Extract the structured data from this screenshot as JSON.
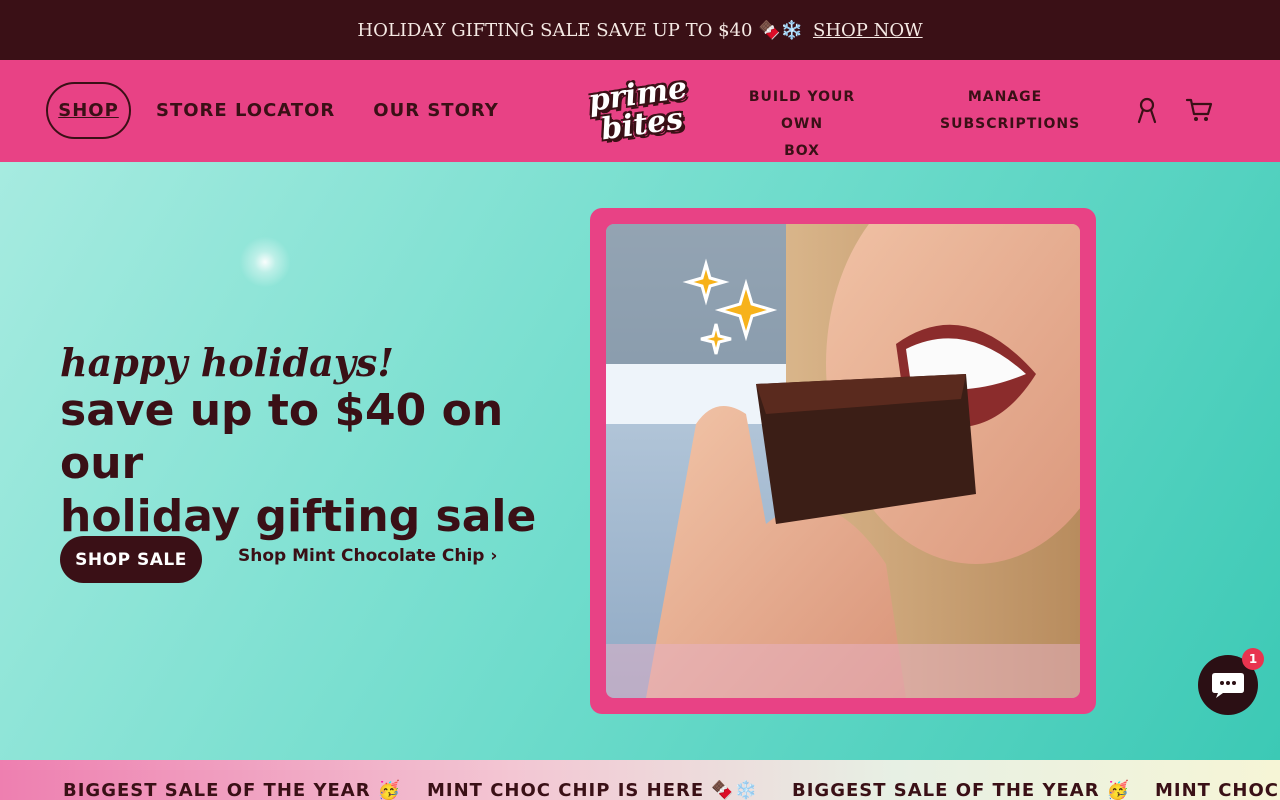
{
  "announcement": {
    "text": "HOLIDAY GIFTING SALE SAVE UP TO $40 🍫❄️",
    "link": "SHOP NOW"
  },
  "header": {
    "nav_left": [
      "SHOP",
      "STORE LOCATOR",
      "OUR STORY"
    ],
    "logo_line1": "prime",
    "logo_line2": "bites",
    "nav_build_line1": "BUILD YOUR OWN",
    "nav_build_line2": "BOX",
    "nav_manage_line1": "MANAGE",
    "nav_manage_line2": "SUBSCRIPTIONS",
    "icons": [
      "account-icon",
      "cart-icon"
    ]
  },
  "hero": {
    "script": "happy holidays!",
    "headline_line1": "save up to $40 on our",
    "headline_line2": "holiday gifting sale",
    "cta_primary": "SHOP SALE",
    "cta_secondary": "Shop Mint Chocolate Chip ›"
  },
  "marquee": {
    "items": [
      "BIGGEST SALE OF THE YEAR 🥳",
      "MINT CHOC CHIP IS HERE 🍫❄️",
      "BIGGEST SALE OF THE YEAR 🥳",
      "MINT CHOC CHIP IS HERE 🍫❄️"
    ]
  },
  "chat": {
    "badge": "1"
  },
  "colors": {
    "announcement_bg": "#3a1016",
    "header_bg": "#e84285",
    "brand_dark": "#3a1016",
    "hero_teal": "#6fdccc"
  }
}
